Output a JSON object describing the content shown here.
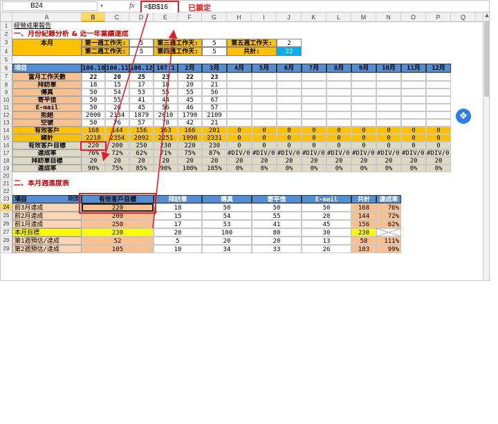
{
  "formula_bar": {
    "name_box": "B24",
    "fx": "fx",
    "formula": "=$B$16",
    "annotation": "已鎖定",
    "dropdown": "▾"
  },
  "columns": [
    "A",
    "B",
    "C",
    "D",
    "E",
    "F",
    "G",
    "H",
    "I",
    "J",
    "K",
    "L",
    "M",
    "N",
    "O",
    "P",
    "Q"
  ],
  "rows": [
    "1",
    "2",
    "3",
    "4",
    "5",
    "6",
    "7",
    "8",
    "9",
    "10",
    "11",
    "12",
    "13",
    "14",
    "15",
    "16",
    "17",
    "18",
    "19",
    "20",
    "21",
    "22",
    "23",
    "24",
    "25",
    "26",
    "27",
    "28",
    "29"
  ],
  "report_title": "經營成果報告",
  "section1_title": "一、月份紀錄分析 & 近一年業績達成",
  "this_month": "本月",
  "week_table": {
    "w1": "第一週工作天:",
    "w1v": "5",
    "w2": "第二週工作天:",
    "w2v": "5",
    "w3": "第三週工作天:",
    "w3v": "5",
    "w4": "第四週工作天:",
    "w4v": "5",
    "w5": "第五週工作天:",
    "w5v": "2",
    "total": "共計:",
    "totalv": "22"
  },
  "table1": {
    "head_item": "項目",
    "head_month": "月份",
    "months": [
      "106.10",
      "106.11",
      "106.12",
      "107.1",
      "2月",
      "3月",
      "4月",
      "5月",
      "6月",
      "7月",
      "8月",
      "9月",
      "10月",
      "11月",
      "12月"
    ],
    "rows": [
      {
        "label": "當月工作天數",
        "values": [
          "22",
          "20",
          "25",
          "23",
          "22",
          "23",
          "",
          "",
          "",
          "",
          "",
          "",
          "",
          "",
          ""
        ]
      },
      {
        "label": "拜訪單",
        "values": [
          "18",
          "15",
          "17",
          "18",
          "20",
          "21",
          "",
          "",
          "",
          "",
          "",
          "",
          "",
          "",
          ""
        ]
      },
      {
        "label": "傳真",
        "values": [
          "50",
          "54",
          "53",
          "55",
          "55",
          "56",
          "",
          "",
          "",
          "",
          "",
          "",
          "",
          "",
          ""
        ]
      },
      {
        "label": "寄平信",
        "values": [
          "50",
          "55",
          "41",
          "44",
          "45",
          "67",
          "",
          "",
          "",
          "",
          "",
          "",
          "",
          "",
          ""
        ]
      },
      {
        "label": "E-mail",
        "values": [
          "50",
          "20",
          "45",
          "56",
          "46",
          "57",
          "",
          "",
          "",
          "",
          "",
          "",
          "",
          "",
          ""
        ]
      },
      {
        "label": "拒絕",
        "values": [
          "2000",
          "2134",
          "1879",
          "2010",
          "1790",
          "2109",
          "",
          "",
          "",
          "",
          "",
          "",
          "",
          "",
          ""
        ]
      },
      {
        "label": "空號",
        "values": [
          "50",
          "76",
          "57",
          "78",
          "42",
          "21",
          "",
          "",
          "",
          "",
          "",
          "",
          "",
          "",
          ""
        ]
      },
      {
        "label": "有效客戶",
        "values": [
          "168",
          "144",
          "156",
          "163",
          "166",
          "201",
          "0",
          "0",
          "0",
          "0",
          "0",
          "0",
          "0",
          "0",
          "0"
        ]
      },
      {
        "label": "總計",
        "values": [
          "2218",
          "2354",
          "2092",
          "2251",
          "1998",
          "2331",
          "0",
          "0",
          "0",
          "0",
          "0",
          "0",
          "0",
          "0",
          "0"
        ]
      },
      {
        "label": "有效客戶目標",
        "values": [
          "220",
          "200",
          "250",
          "230",
          "220",
          "230",
          "0",
          "0",
          "0",
          "0",
          "0",
          "0",
          "0",
          "0",
          "0"
        ]
      },
      {
        "label": "達成率",
        "values": [
          "76%",
          "72%",
          "62%",
          "71%",
          "75%",
          "87%",
          "#DIV/0!",
          "#DIV/0!",
          "#DIV/0!",
          "#DIV/0!",
          "#DIV/0!",
          "#DIV/0!",
          "#DIV/0!",
          "#DIV/0!",
          "#DIV/0!"
        ]
      },
      {
        "label": "拜訪單目標",
        "values": [
          "20",
          "20",
          "20",
          "20",
          "20",
          "20",
          "20",
          "20",
          "20",
          "20",
          "20",
          "20",
          "20",
          "20",
          "20"
        ]
      },
      {
        "label": "達成率",
        "values": [
          "90%",
          "75%",
          "85%",
          "90%",
          "100%",
          "105%",
          "0%",
          "0%",
          "0%",
          "0%",
          "0%",
          "0%",
          "0%",
          "0%",
          "0%"
        ]
      }
    ]
  },
  "section2_title": "二、本月週進度表",
  "table2": {
    "headers": [
      "項目",
      "期間",
      "有效客戶目標",
      "拜訪單",
      "傳真",
      "寄平信",
      "E-mail",
      "共計",
      "達成率"
    ],
    "rows": [
      {
        "label": "前3月達成",
        "values": [
          "220",
          "18",
          "50",
          "50",
          "50",
          "168",
          "76%"
        ]
      },
      {
        "label": "前2月達成",
        "values": [
          "200",
          "15",
          "54",
          "55",
          "20",
          "144",
          "72%"
        ]
      },
      {
        "label": "前1月達成",
        "values": [
          "250",
          "17",
          "53",
          "41",
          "45",
          "156",
          "62%"
        ]
      },
      {
        "label": "本月目標",
        "values": [
          "230",
          "20",
          "100",
          "80",
          "30",
          "230",
          ""
        ]
      },
      {
        "label": "第1週預估/達成",
        "values": [
          "52",
          "5",
          "20",
          "20",
          "13",
          "58",
          "111%"
        ]
      },
      {
        "label": "第2週預估/達成",
        "values": [
          "105",
          "10",
          "34",
          "33",
          "26",
          "103",
          "99%"
        ]
      }
    ]
  },
  "colors": {
    "orange": "#ffc000",
    "salmon": "#fac090",
    "peach": "#fcd5b4",
    "blue": "#538dd5",
    "tan": "#ddd9c4",
    "yellow": "#ffff00",
    "red": "#e0202a"
  }
}
